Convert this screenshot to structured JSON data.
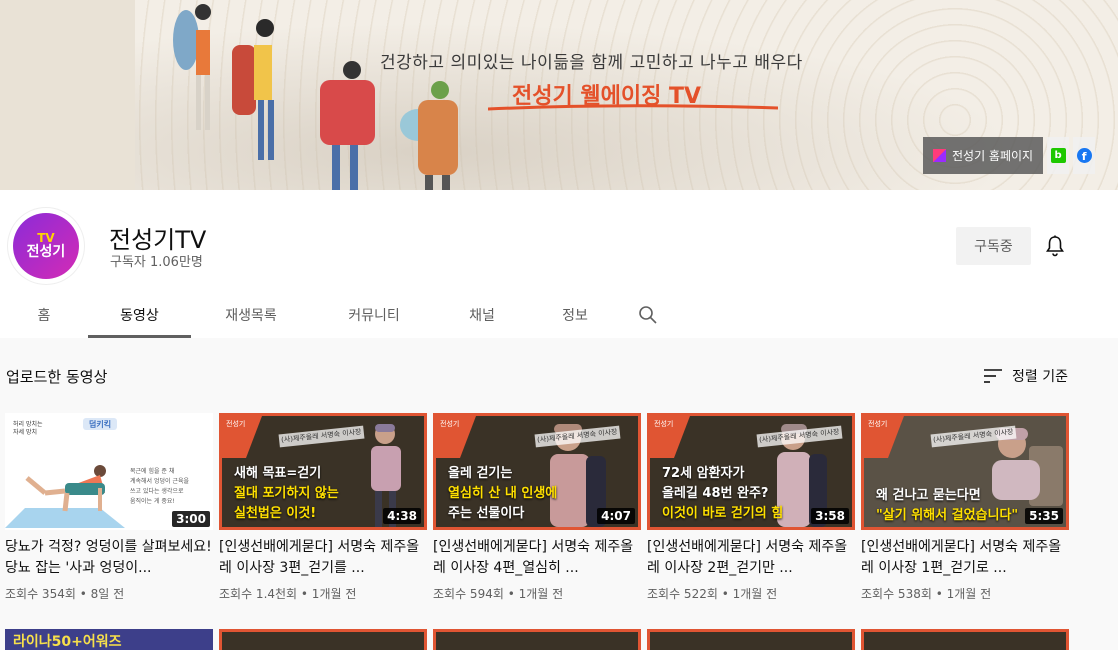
{
  "banner": {
    "tagline": "건강하고 의미있는 나이듦을 함께 고민하고 나누고 배우다",
    "title": "전성기 웰에이징 TV",
    "links": {
      "homepage_label": "전성기 홈페이지",
      "naver_icon": "naver-blog-icon",
      "facebook_icon": "facebook-icon"
    }
  },
  "channel": {
    "avatar_tv": "TV",
    "avatar_name": "전성기",
    "name": "전성기TV",
    "subscribers": "구독자 1.06만명",
    "subscribe_label": "구독중"
  },
  "tabs": [
    {
      "label": "홈"
    },
    {
      "label": "동영상"
    },
    {
      "label": "재생목록"
    },
    {
      "label": "커뮤니티"
    },
    {
      "label": "채널"
    },
    {
      "label": "정보"
    }
  ],
  "section": {
    "title": "업로드한 동영상",
    "sort_label": "정렬 기준"
  },
  "videos": [
    {
      "duration": "3:00",
      "title": "당뇨가 걱정? 엉덩이를 살펴보세요! 당뇨 잡는 '사과 엉덩이...",
      "meta": "조회수 354회 • 8일 전",
      "thumb_badge": "덤키킥"
    },
    {
      "duration": "4:38",
      "title": "[인생선배에게묻다] 서명숙 제주올레 이사장 3편_걷기를 ...",
      "meta": "조회수 1.4천회 • 1개월 전",
      "caption": [
        "새해 목표=걷기",
        "절대 포기하지 않는",
        "실천법은 이것!"
      ]
    },
    {
      "duration": "4:07",
      "title": "[인생선배에게묻다] 서명숙 제주올레 이사장 4편_열심히 ...",
      "meta": "조회수 594회 • 1개월 전",
      "caption": [
        "올레 걷기는",
        "열심히 산 내 인생에",
        "주는 선물이다"
      ]
    },
    {
      "duration": "3:58",
      "title": "[인생선배에게묻다] 서명숙 제주올레 이사장 2편_걷기만 ...",
      "meta": "조회수 522회 • 1개월 전",
      "caption": [
        "72세 암환자가",
        "올레길 48번 완주?",
        "이것이 바로 걷기의 힘"
      ]
    },
    {
      "duration": "5:35",
      "title": "[인생선배에게묻다] 서명숙 제주올레 이사장 1편_걷기로 ...",
      "meta": "조회수 538회 • 1개월 전",
      "caption": [
        "왜 걷나고 묻는다면",
        "\"살기 위해서 걸었습니다\""
      ]
    }
  ],
  "row2_first_text": "라이나50+어워즈",
  "brand_tag": "전성기",
  "sign_text": "(사)제주올레 서명숙 이사장",
  "colors": {
    "accent": "#e05533",
    "caption_yellow": "#ffe000"
  }
}
